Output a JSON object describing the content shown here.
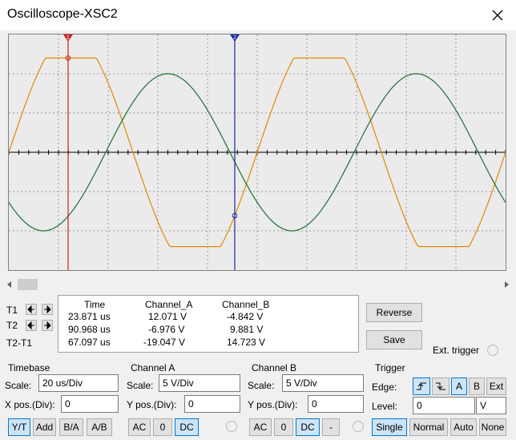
{
  "window": {
    "title": "Oscilloscope-XSC2",
    "close_icon": "close-icon"
  },
  "cursor_markers": {
    "t1": "1",
    "t2": "2"
  },
  "colors": {
    "channel_a": "#e08a00",
    "channel_b": "#1f6e3a",
    "cursor_1": "#d61f1f",
    "cursor_2": "#1a24a8",
    "screen_bg": "#ebebeb",
    "accent": "#0078d7"
  },
  "chart_data": {
    "type": "line",
    "period_us": 100,
    "x_range_us": [
      0,
      200
    ],
    "cursor_time_us": [
      23.871,
      90.968
    ],
    "grid": true,
    "series": [
      {
        "name": "Channel_A",
        "amplitude_div": 2.4,
        "phase": "sine, peak near 25 us",
        "clipped_at_div": 2.4
      },
      {
        "name": "Channel_B",
        "amplitude_div": 2.0,
        "phase": "cosine shifted, trough near 40 us"
      }
    ]
  },
  "measurements": {
    "headers": [
      "Time",
      "Channel_A",
      "Channel_B"
    ],
    "rows": [
      {
        "label": "T1",
        "time": "23.871 us",
        "a": "12.071 V",
        "b": "-4.842 V"
      },
      {
        "label": "T2",
        "time": "90.968 us",
        "a": "-6.976 V",
        "b": "9.881 V"
      },
      {
        "label": "T2-T1",
        "time": "67.097 us",
        "a": "-19.047 V",
        "b": "14.723 V"
      }
    ]
  },
  "buttons": {
    "reverse": "Reverse",
    "save": "Save"
  },
  "ext_trigger": "Ext. trigger",
  "timebase": {
    "title": "Timebase",
    "scale_label": "Scale:",
    "scale": "20 us/Div",
    "xpos_label": "X pos.(Div):",
    "xpos": "0",
    "modes": [
      "Y/T",
      "Add",
      "B/A",
      "A/B"
    ]
  },
  "channel_a": {
    "title": "Channel A",
    "scale_label": "Scale:",
    "scale": "5  V/Div",
    "ypos_label": "Y pos.(Div):",
    "ypos": "0",
    "coupling": [
      "AC",
      "0",
      "DC"
    ]
  },
  "channel_b": {
    "title": "Channel B",
    "scale_label": "Scale:",
    "scale": "5  V/Div",
    "ypos_label": "Y pos.(Div):",
    "ypos": "0",
    "coupling": [
      "AC",
      "0",
      "DC",
      "-"
    ]
  },
  "trigger": {
    "title": "Trigger",
    "edge_label": "Edge:",
    "edge_rising": "rising-edge-icon",
    "edge_falling": "falling-edge-icon",
    "sources": [
      "A",
      "B",
      "Ext"
    ],
    "level_label": "Level:",
    "level": "0",
    "level_unit": "V",
    "modes": [
      "Single",
      "Normal",
      "Auto",
      "None"
    ]
  }
}
